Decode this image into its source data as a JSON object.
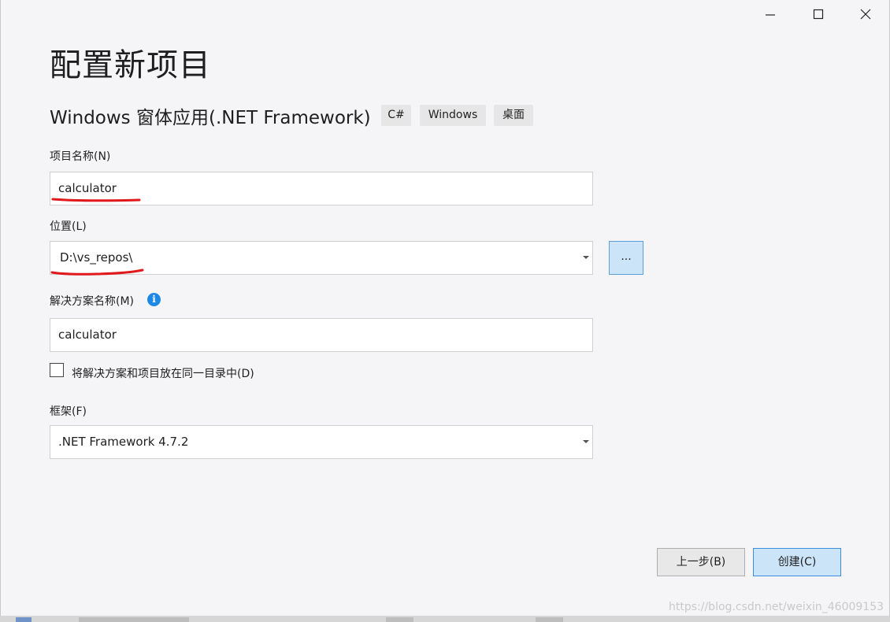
{
  "window": {
    "minimize_icon": "minimize-icon",
    "maximize_icon": "maximize-icon",
    "close_icon": "close-icon"
  },
  "page_title": "配置新项目",
  "template": {
    "name": "Windows 窗体应用(.NET Framework)",
    "tags": [
      "C#",
      "Windows",
      "桌面"
    ]
  },
  "project_name": {
    "label": "项目名称(N)",
    "value": "calculator"
  },
  "location": {
    "label": "位置(L)",
    "value": "D:\\vs_repos\\",
    "browse_label": "..."
  },
  "solution_name": {
    "label": "解决方案名称(M)",
    "value": "calculator",
    "info_icon": "info-icon",
    "info_glyph": "i"
  },
  "same_dir_checkbox": {
    "label": "将解决方案和项目放在同一目录中(D)",
    "checked": false
  },
  "framework": {
    "label": "框架(F)",
    "value": ".NET Framework 4.7.2"
  },
  "buttons": {
    "back": "上一步(B)",
    "create": "创建(C)"
  },
  "watermark": "https://blog.csdn.net/weixin_46009153",
  "colors": {
    "accent_blue": "#cce4f7",
    "accent_border": "#3c8ce0",
    "annotation_red": "#e0191c"
  }
}
